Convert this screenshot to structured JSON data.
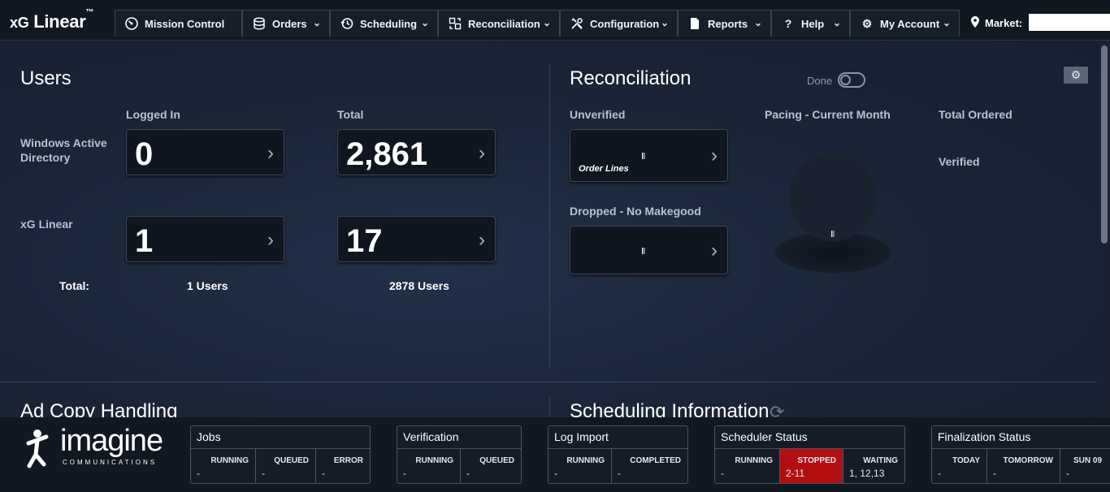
{
  "app": {
    "logo_prefix": "xG",
    "logo_name": "Linear",
    "logo_tm": "™"
  },
  "nav": {
    "items": [
      {
        "label": "Mission Control",
        "icon": "gauge-icon"
      },
      {
        "label": "Orders",
        "icon": "database-icon"
      },
      {
        "label": "Scheduling",
        "icon": "clock-history-icon"
      },
      {
        "label": "Reconciliation",
        "icon": "reconcile-icon"
      },
      {
        "label": "Configuration",
        "icon": "tools-icon"
      },
      {
        "label": "Reports",
        "icon": "document-icon"
      },
      {
        "label": "Help",
        "icon": "question-icon"
      },
      {
        "label": "My Account",
        "icon": "gear-icon"
      }
    ],
    "market_label": "Market:",
    "market_value": ""
  },
  "users": {
    "title": "Users",
    "col_logged_in": "Logged In",
    "col_total": "Total",
    "row1_label": "Windows Active Directory",
    "row2_label": "xG Linear",
    "wad_logged_in": "0",
    "wad_total": "2,861",
    "xg_logged_in": "1",
    "xg_total": "17",
    "total_label": "Total:",
    "total_logged_in": "1 Users",
    "total_total": "2878 Users"
  },
  "reconciliation": {
    "title": "Reconciliation",
    "done_label": "Done",
    "unverified_label": "Unverified",
    "unverified_sublabel": "Order Lines",
    "dropped_label": "Dropped - No Makegood",
    "pacing_label": "Pacing - Current Month",
    "total_ordered_label": "Total Ordered",
    "verified_label": "Verified"
  },
  "sections": {
    "ad_copy": "Ad Copy Handling",
    "scheduling_info": "Scheduling Information"
  },
  "footer": {
    "brand": "imagine",
    "brand_sub": "COMMUNICATIONS",
    "panels": [
      {
        "title": "Jobs",
        "cells": [
          {
            "h": "RUNNING",
            "v": "-"
          },
          {
            "h": "QUEUED",
            "v": "-"
          },
          {
            "h": "ERROR",
            "v": "-"
          }
        ]
      },
      {
        "title": "Verification",
        "cells": [
          {
            "h": "RUNNING",
            "v": "-"
          },
          {
            "h": "QUEUED",
            "v": "-"
          }
        ]
      },
      {
        "title": "Log Import",
        "cells": [
          {
            "h": "RUNNING",
            "v": "-"
          },
          {
            "h": "COMPLETED",
            "v": "-"
          }
        ]
      },
      {
        "title": "Scheduler Status",
        "cells": [
          {
            "h": "RUNNING",
            "v": "-"
          },
          {
            "h": "STOPPED",
            "v": "2-11"
          },
          {
            "h": "WAITING",
            "v": "1, 12,13"
          }
        ]
      },
      {
        "title": "Finalization Status",
        "cells": [
          {
            "h": "TODAY",
            "v": "-"
          },
          {
            "h": "TOMORROW",
            "v": "-"
          },
          {
            "h": "SUN 09",
            "v": "-"
          }
        ]
      }
    ]
  },
  "colors": {
    "stopped": "#b40f10",
    "background": "#1b2535"
  }
}
